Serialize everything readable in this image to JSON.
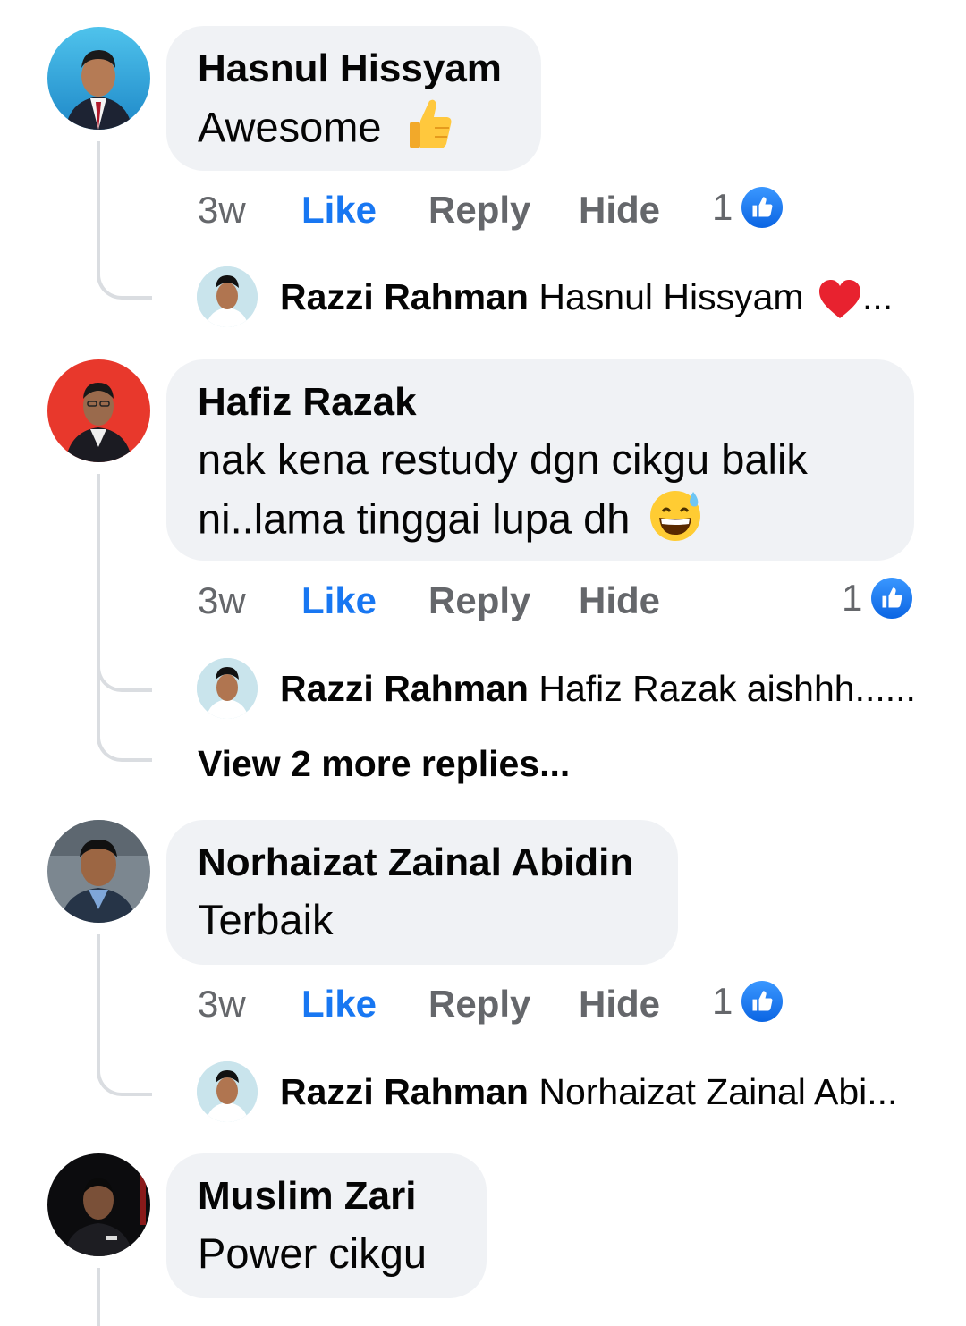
{
  "comments": [
    {
      "author": "Hasnul Hissyam",
      "lines": [
        "Awesome"
      ],
      "emoji": "thumbs-up",
      "time": "3w",
      "like": "Like",
      "reply": "Reply",
      "hide": "Hide",
      "reactions": "1",
      "reply_preview": {
        "name": "Razzi Rahman",
        "text": "Hasnul Hissyam",
        "suffix": "..."
      }
    },
    {
      "author": "Hafiz Razak",
      "lines": [
        "nak kena restudy dgn cikgu balik",
        "ni..lama tinggai lupa dh"
      ],
      "emoji": "grinning-sweat",
      "time": "3w",
      "like": "Like",
      "reply": "Reply",
      "hide": "Hide",
      "reactions": "1",
      "reply_preview": {
        "name": "Razzi Rahman",
        "text": "Hafiz Razak aishhh......"
      },
      "view_more": "View 2 more replies..."
    },
    {
      "author": "Norhaizat Zainal Abidin",
      "lines": [
        "Terbaik"
      ],
      "time": "3w",
      "like": "Like",
      "reply": "Reply",
      "hide": "Hide",
      "reactions": "1",
      "reply_preview": {
        "name": "Razzi Rahman",
        "text": "Norhaizat Zainal Abi..."
      }
    },
    {
      "author": "Muslim Zari",
      "lines": [
        "Power cikgu"
      ]
    }
  ],
  "colors": {
    "bubble": "#f0f2f5",
    "like_blue": "#1877f2",
    "meta_gray": "#65676b",
    "thread_line": "#dadde1"
  },
  "icons": {
    "like_badge": "thumbs-up-icon",
    "heart": "heart-icon"
  }
}
